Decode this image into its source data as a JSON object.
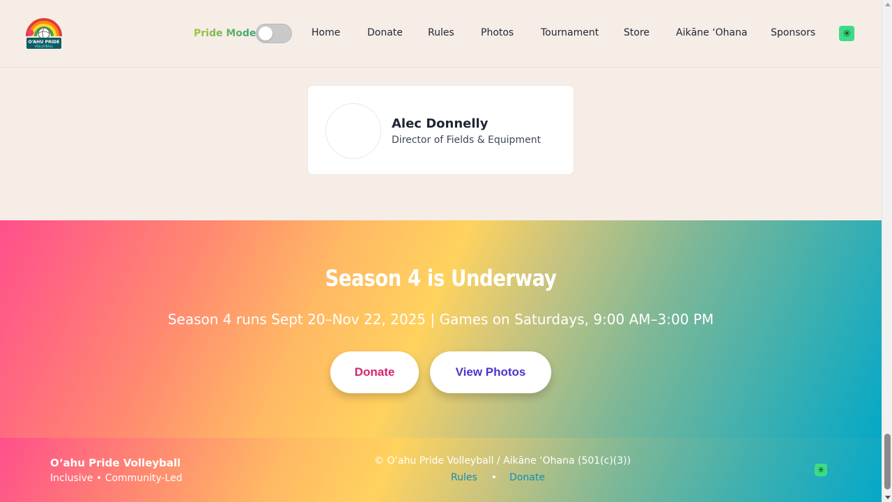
{
  "header": {
    "logo_text": "O'AHU PRIDE VOLLEYBALL",
    "pride_mode_label": "Pride Mode",
    "pride_mode_on": false,
    "nav": [
      "Home",
      "Donate",
      "Rules",
      "Photos",
      "Tournament",
      "Store",
      "Aikāne ʻOhana",
      "Sponsors"
    ],
    "icon": "linktree-icon"
  },
  "member": {
    "name": "Alec Donnelly",
    "role": "Director of Fields & Equipment"
  },
  "hero": {
    "title": "Season 4 is Underway",
    "subtitle": "Season 4 runs Sept 20–Nov 22, 2025 | Games on Saturdays, 9:00 AM–3:00 PM",
    "donate_label": "Donate",
    "photos_label": "View Photos"
  },
  "footer": {
    "brand": "Oʻahu Pride Volleyball",
    "tagline": "Inclusive • Community-Led",
    "copyright": "© Oʻahu Pride Volleyball / Aikāne ʻOhana (501(c)(3))",
    "links": [
      "Rules",
      "Donate"
    ],
    "separator": "•",
    "icon": "linktree-icon"
  },
  "colors": {
    "background": "#f6ede7",
    "accent_green": "#3ddc84",
    "donate_pink": "#d6236e",
    "photos_indigo": "#4a35cf",
    "footer_link": "#128db8"
  }
}
